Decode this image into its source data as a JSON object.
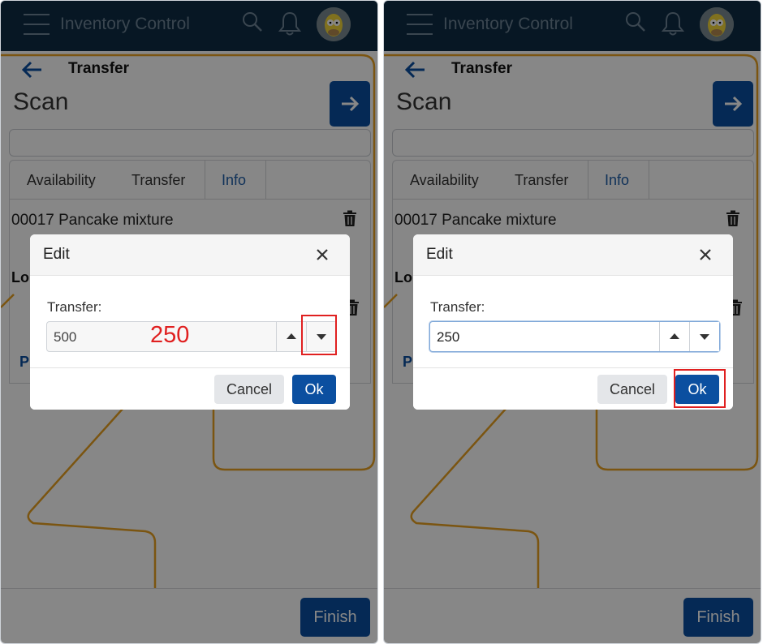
{
  "app": {
    "title": "Inventory Control"
  },
  "page": {
    "breadcrumb": "Transfer",
    "heading": "Scan"
  },
  "tabs": [
    "Availability",
    "Transfer",
    "Info"
  ],
  "active_tab": "Info",
  "item": {
    "name": "00017 Pancake mixture",
    "location_label_partial": "Lo",
    "partial_link": "P"
  },
  "footer": {
    "finish_label": "Finish"
  },
  "dialog_left": {
    "title": "Edit",
    "field_label": "Transfer:",
    "value": "500",
    "annotation": "250",
    "cancel_label": "Cancel",
    "ok_label": "Ok"
  },
  "dialog_right": {
    "title": "Edit",
    "field_label": "Transfer:",
    "value": "250",
    "cancel_label": "Cancel",
    "ok_label": "Ok"
  },
  "colors": {
    "header": "#0f2d44",
    "primary": "#0b4fa0",
    "highlight": "#e02020",
    "route": "#e8a020"
  },
  "icons": [
    "menu-icon",
    "search-icon",
    "bell-icon",
    "avatar",
    "back-arrow-icon",
    "arrow-right-icon",
    "trash-icon",
    "close-icon",
    "caret-up-icon",
    "caret-down-icon"
  ]
}
